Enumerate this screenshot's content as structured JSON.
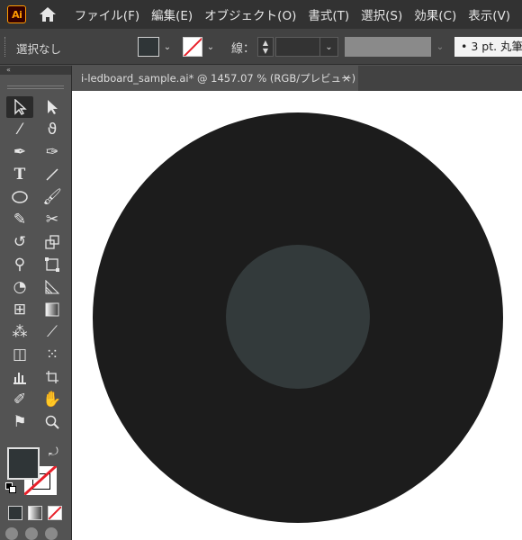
{
  "app": {
    "logo_text": "Ai",
    "logo_color": "#ff9a00"
  },
  "menu": {
    "items": [
      {
        "label": "ファイル(F)"
      },
      {
        "label": "編集(E)"
      },
      {
        "label": "オブジェクト(O)"
      },
      {
        "label": "書式(T)"
      },
      {
        "label": "選択(S)"
      },
      {
        "label": "効果(C)"
      },
      {
        "label": "表示(V)"
      }
    ]
  },
  "control": {
    "selection_label": "選択なし",
    "fill_color": "#2f3537",
    "stroke_label": "線：",
    "stroke_width": "",
    "brush_label": "•   3 pt. 丸筆",
    "chevron": "⌄"
  },
  "document": {
    "tab_title": "i-ledboard_sample.ai* @ 1457.07 % (RGB/プレビュー)",
    "close_label": "×"
  },
  "toolbar": {
    "collapse_label": "«",
    "tools": [
      [
        "selection-tool",
        "direct-selection-tool"
      ],
      [
        "magic-wand-tool",
        "lasso-tool"
      ],
      [
        "pen-tool",
        "curvature-tool"
      ],
      [
        "type-tool",
        "line-tool"
      ],
      [
        "ellipse-tool",
        "paintbrush-tool"
      ],
      [
        "shaper-tool",
        "scissors-tool"
      ],
      [
        "rotate-tool",
        "scale-tool"
      ],
      [
        "puppet-warp-tool",
        "free-transform-tool"
      ],
      [
        "shape-builder-tool",
        "perspective-grid-tool"
      ],
      [
        "mesh-tool",
        "gradient-tool"
      ],
      [
        "eyedropper-tool",
        "measure-tool"
      ],
      [
        "blend-tool",
        "symbol-sprayer-tool"
      ],
      [
        "column-graph-tool",
        "artboard-tool"
      ],
      [
        "slice-tool",
        "hand-tool"
      ],
      [
        "flag-icon",
        "zoom-tool"
      ]
    ],
    "fill_color": "#2f3537",
    "swap_label": "⤾"
  },
  "artwork": {
    "outer_circle_color": "#1c1c1c",
    "inner_circle_color": "#333a3b",
    "canvas_color": "#ffffff"
  }
}
